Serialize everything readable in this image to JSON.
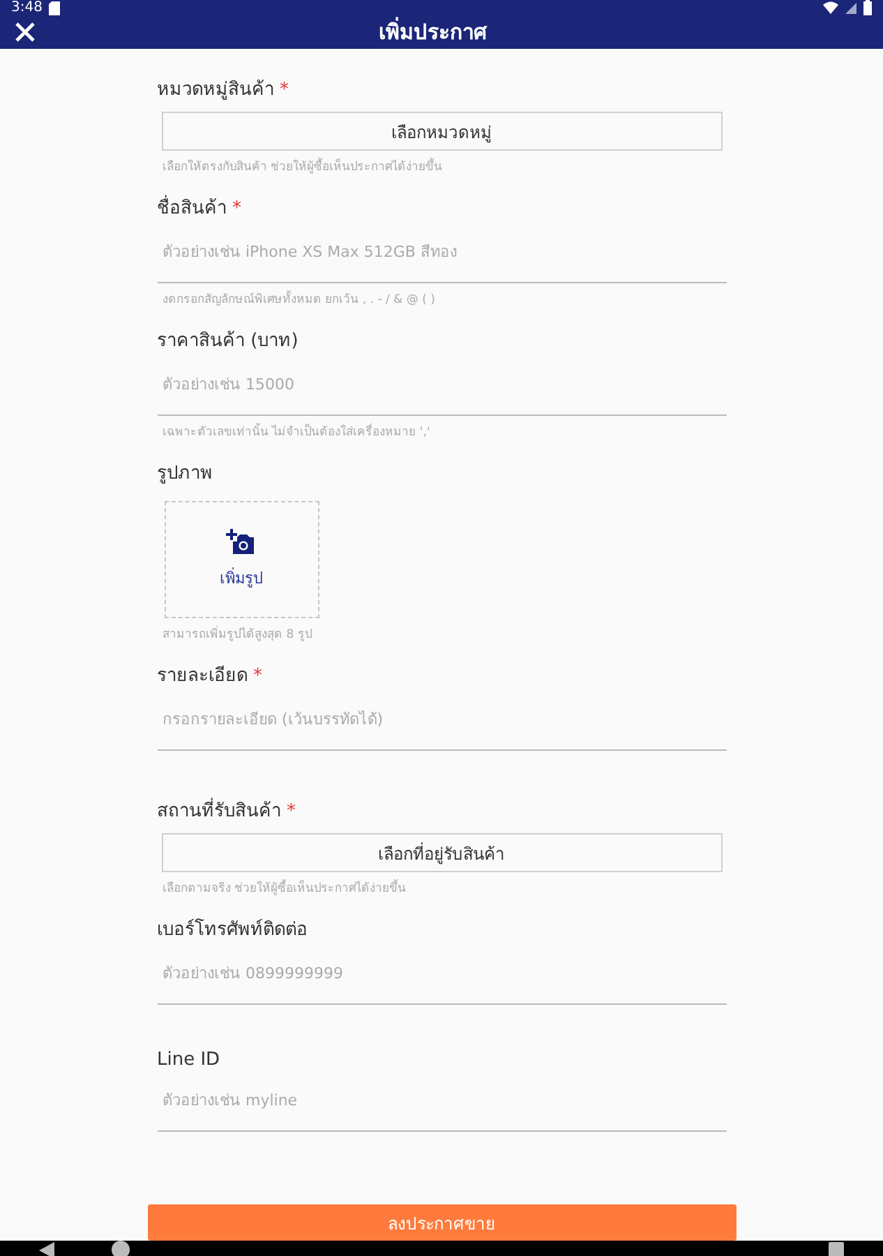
{
  "status_bar": {
    "time": "3:48"
  },
  "app_bar": {
    "title": "เพิ่มประกาศ"
  },
  "fields": [
    {
      "kind": "select",
      "label": "หมวดหมู่สินค้า",
      "required_mark": "*",
      "value": "เลือกหมวดหมู่",
      "hint": "เลือกให้ตรงกับสินค้า ช่วยให้ผู้ซื้อเห็นประกาศได้ง่ายขึ้น"
    },
    {
      "kind": "text",
      "label": "ชื่อสินค้า",
      "required_mark": "*",
      "placeholder": "ตัวอย่างเช่น iPhone XS Max 512GB สีทอง",
      "hint": "งดกรอกสัญลักษณ์พิเศษทั้งหมด ยกเว้น , . - / & @ ( )"
    },
    {
      "kind": "text",
      "label": "ราคาสินค้า (บาท)",
      "placeholder": "ตัวอย่างเช่น 15000",
      "hint": "เฉพาะตัวเลขเท่านั้น ไม่จำเป็นต้องใส่เครื่องหมาย ','"
    },
    {
      "kind": "photo",
      "label": "รูปภาพ",
      "value": "เพิ่มรูป",
      "hint": "สามารถเพิ่มรูปได้สูงสุด 8 รูป"
    },
    {
      "kind": "text",
      "label": "รายละเอียด",
      "required_mark": "*",
      "placeholder": "กรอกรายละเอียด (เว้นบรรทัดได้)"
    },
    {
      "kind": "select",
      "label": "สถานที่รับสินค้า",
      "required_mark": "*",
      "value": "เลือกที่อยู่รับสินค้า",
      "hint": "เลือกตามจริง ช่วยให้ผู้ซื้อเห็นประกาศได้ง่ายขึ้น"
    },
    {
      "kind": "text",
      "label": "เบอร์โทรศัพท์ติดต่อ",
      "placeholder": "ตัวอย่างเช่น 0899999999"
    },
    {
      "kind": "text",
      "label": "Line ID",
      "placeholder": "ตัวอย่างเช่น myline"
    }
  ],
  "submit": {
    "label": "ลงประกาศขาย"
  }
}
